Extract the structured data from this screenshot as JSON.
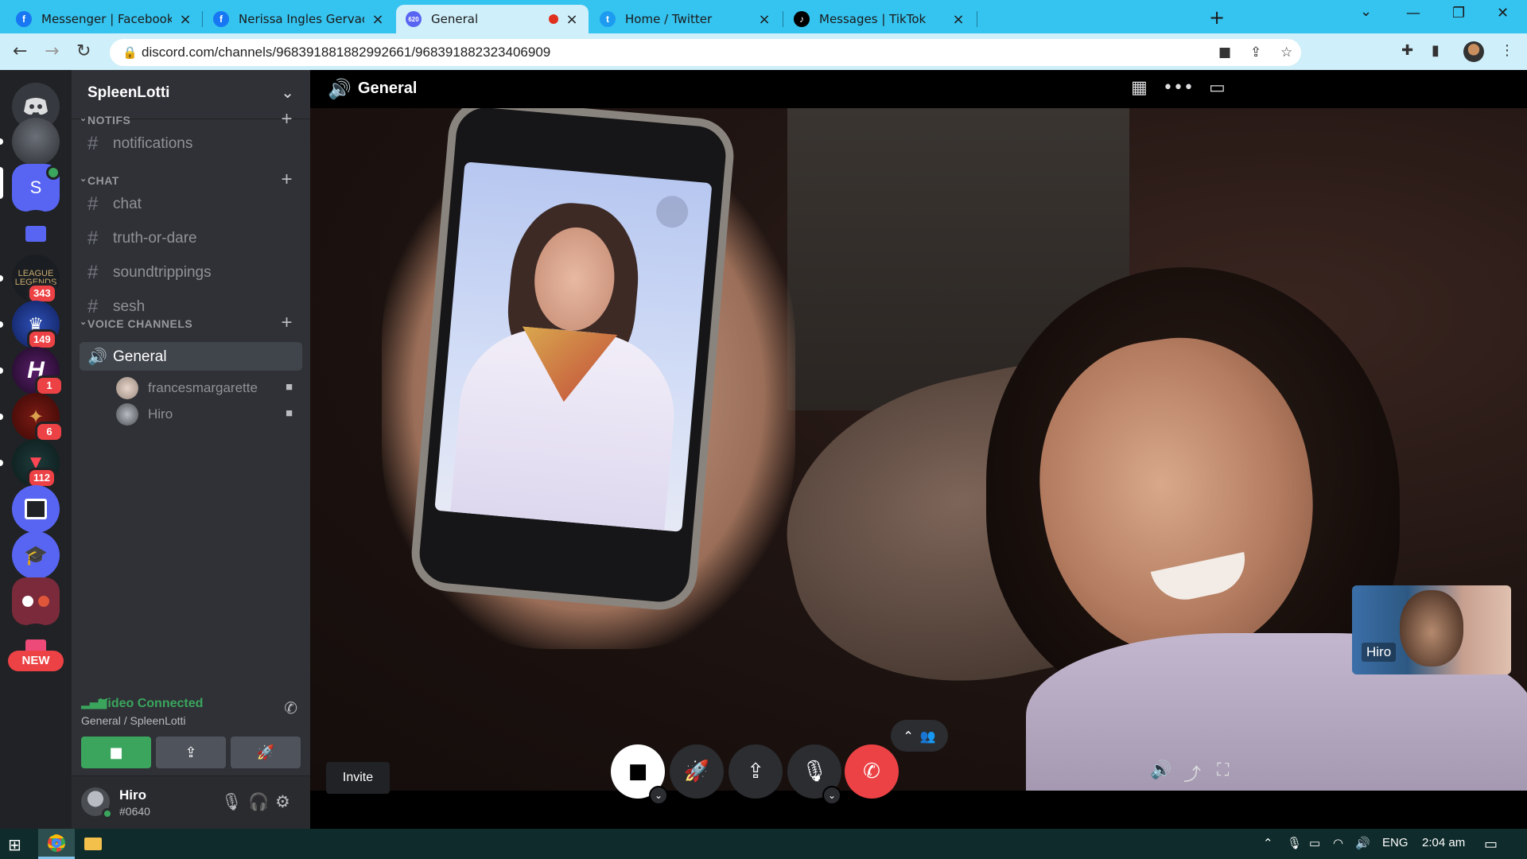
{
  "browser": {
    "tabs": [
      {
        "title": "Messenger | Facebook",
        "icon": "facebook-icon",
        "color": "#1877f2",
        "glyph": "f"
      },
      {
        "title": "Nerissa Ingles Gervacio-del Rosar",
        "icon": "facebook-icon",
        "color": "#1877f2",
        "glyph": "f"
      },
      {
        "title": "General",
        "icon": "discord-icon",
        "color": "#5865f2",
        "glyph": "620",
        "active": true
      },
      {
        "title": "Home / Twitter",
        "icon": "twitter-icon",
        "color": "#1d9bf0",
        "glyph": "t"
      },
      {
        "title": "Messages | TikTok",
        "icon": "tiktok-icon",
        "color": "#000000",
        "glyph": "♪"
      }
    ],
    "url": "discord.com/channels/968391881882992661/968391882323406909"
  },
  "rail": {
    "badges": [
      "343",
      "149",
      "1",
      "6",
      "112"
    ],
    "server_initial": "S",
    "league_text": "LEAGUE\nLEGENDS",
    "new_label": "NEW"
  },
  "sidebar": {
    "server_name": "SpleenLotti",
    "categories": [
      {
        "name": "NOTIFS"
      },
      {
        "name": "CHAT"
      },
      {
        "name": "VOICE CHANNELS"
      }
    ],
    "text_channels": [
      "notifications",
      "chat",
      "truth-or-dare",
      "soundtrippings",
      "sesh"
    ],
    "voice_channel": "General",
    "voice_users": [
      "francesmargarette",
      "Hiro"
    ],
    "voice_panel": {
      "status": "Video Connected",
      "channel": "General / SpleenLotti"
    },
    "user": {
      "name": "Hiro",
      "tag": "#0640"
    }
  },
  "stage": {
    "title": "General",
    "self_name": "Hiro",
    "invite_label": "Invite"
  },
  "taskbar": {
    "language": "ENG",
    "time": "2:04 am"
  },
  "colors": {
    "discord_blurple": "#5865f2",
    "online_green": "#3ba55d",
    "danger_red": "#ed4245",
    "chrome_tab_bar": "#35c3ef"
  }
}
